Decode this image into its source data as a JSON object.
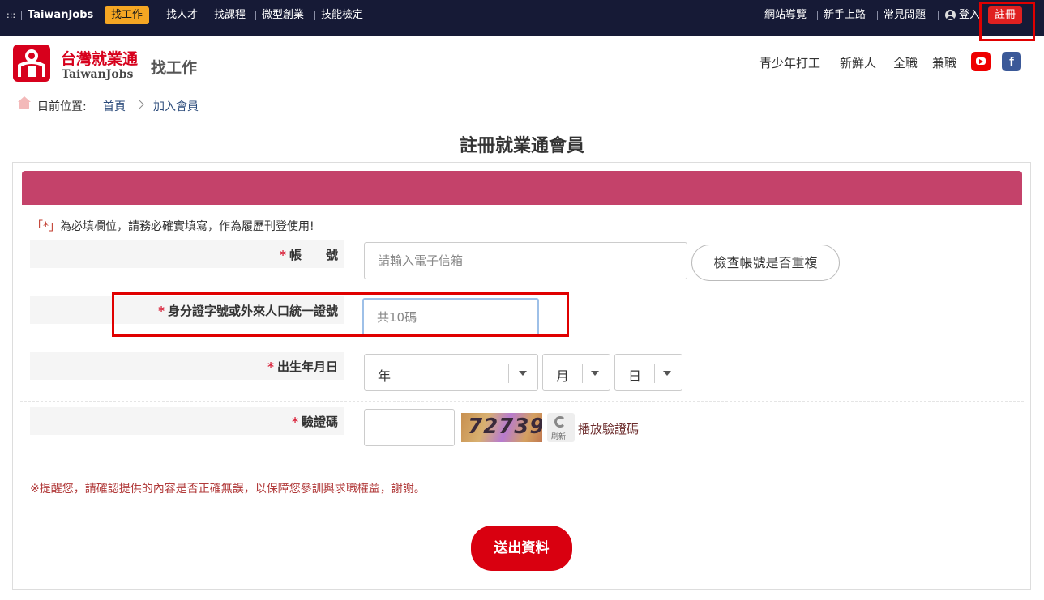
{
  "topbar": {
    "menu_glyph": ":::",
    "brand": "TaiwanJobs",
    "nav": [
      "找工作",
      "找人才",
      "找課程",
      "微型創業",
      "技能檢定"
    ],
    "right": [
      "網站導覽",
      "新手上路",
      "常見問題"
    ],
    "login": "登入",
    "register": "註冊"
  },
  "header": {
    "logo_ch": "台灣就業通",
    "logo_en": "TaiwanJobs",
    "section_title": "找工作",
    "nav": [
      "青少年打工",
      "新鮮人",
      "全職",
      "兼職"
    ],
    "facebook_glyph": "f"
  },
  "breadcrumb": {
    "label": "目前位置:",
    "home": "首頁",
    "current": "加入會員"
  },
  "page_title": "註冊就業通會員",
  "form": {
    "note_mark": "「*」",
    "note_text": "為必填欄位，請務必確實填寫，作為履歷刊登使用!",
    "star": "*",
    "account_label": "帳　　號",
    "account_placeholder": "請輸入電子信箱",
    "check_button": "檢查帳號是否重複",
    "id_label": "身分證字號或外來人口統一證號",
    "id_placeholder": "共10碼",
    "birth_label": "出生年月日",
    "year": "年",
    "month": "月",
    "day": "日",
    "captcha_label": "驗證碼",
    "captcha_code": "72739",
    "refresh_label": "刷新",
    "play_captcha": "播放驗證碼",
    "reminder": "※提醒您，請確認提供的內容是否正確無誤，以保障您參訓與求職權益，謝謝。",
    "submit": "送出資料"
  },
  "colors": {
    "topbar": "#161a36",
    "active_nav": "#f5a623",
    "register": "#e02020",
    "banner": "#c4426a",
    "submit": "#d90010",
    "highlight": "#e00000"
  }
}
